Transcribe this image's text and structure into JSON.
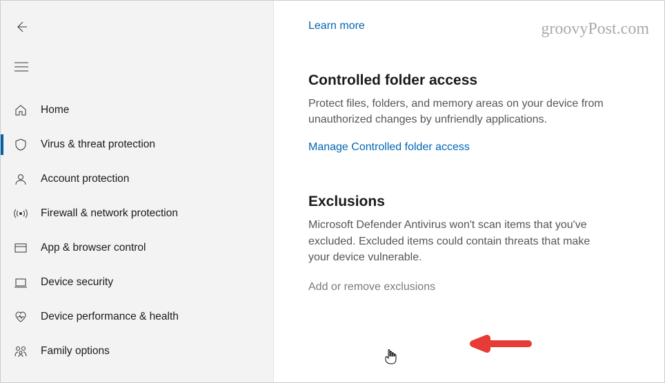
{
  "watermark": "groovyPost.com",
  "sidebar": {
    "items": [
      {
        "label": "Home",
        "icon": "home-icon"
      },
      {
        "label": "Virus & threat protection",
        "icon": "shield-icon"
      },
      {
        "label": "Account protection",
        "icon": "person-icon"
      },
      {
        "label": "Firewall & network protection",
        "icon": "antenna-icon"
      },
      {
        "label": "App & browser control",
        "icon": "window-icon"
      },
      {
        "label": "Device security",
        "icon": "device-icon"
      },
      {
        "label": "Device performance & health",
        "icon": "heart-icon"
      },
      {
        "label": "Family options",
        "icon": "family-icon"
      }
    ]
  },
  "content": {
    "learnMore": "Learn more",
    "controlledFolder": {
      "heading": "Controlled folder access",
      "desc": "Protect files, folders, and memory areas on your device from unauthorized changes by unfriendly applications.",
      "link": "Manage Controlled folder access"
    },
    "exclusions": {
      "heading": "Exclusions",
      "desc": "Microsoft Defender Antivirus won't scan items that you've excluded. Excluded items could contain threats that make your device vulnerable.",
      "link": "Add or remove exclusions"
    }
  }
}
